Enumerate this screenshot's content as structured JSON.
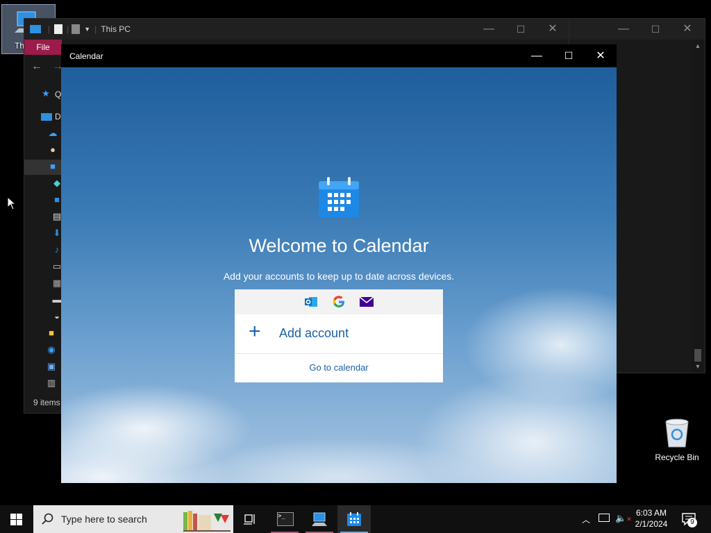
{
  "desktop": {
    "thispc_label": "Th",
    "recycle_label": "Recycle Bin"
  },
  "explorer": {
    "title": "This PC",
    "file_tab": "File",
    "status": "9 items",
    "sidebar_letters": [
      "Q",
      "D"
    ]
  },
  "calendar": {
    "title": "Calendar",
    "heading": "Welcome to Calendar",
    "subtitle": "Add your accounts to keep up to date across devices.",
    "add_account": "Add account",
    "go_to_calendar": "Go to calendar"
  },
  "taskbar": {
    "search_placeholder": "Type here to search",
    "time": "6:03 AM",
    "date": "2/1/2024",
    "notification_count": "9"
  },
  "colors": {
    "calendar_blue": "#1e88e5",
    "file_tab": "#9b1b4b",
    "link_blue": "#1a5fa8"
  }
}
